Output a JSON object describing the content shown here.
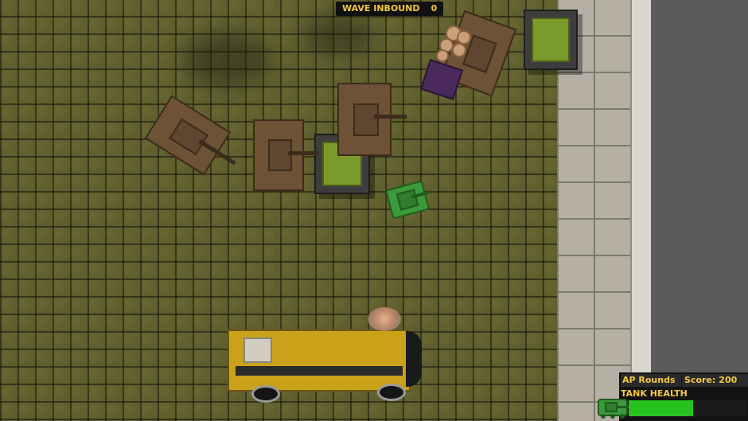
{
  "hud": {
    "wave_label": "WAVE INBOUND",
    "wave_count": "0",
    "ammo_type": "AP Rounds",
    "score_label": "Score:",
    "score_value": "200",
    "health_label": "TANK HEALTH",
    "health_fraction": 0.55
  },
  "colors": {
    "hud_text": "#f3c842",
    "health_fill": "#27c21e",
    "player_tank": "#3d9a3a",
    "enemy_tank": "#6e5236",
    "bus": "#c9a21a"
  },
  "icons": {
    "player_tank": "green-tank-icon",
    "hud_tank": "tank-health-icon"
  }
}
